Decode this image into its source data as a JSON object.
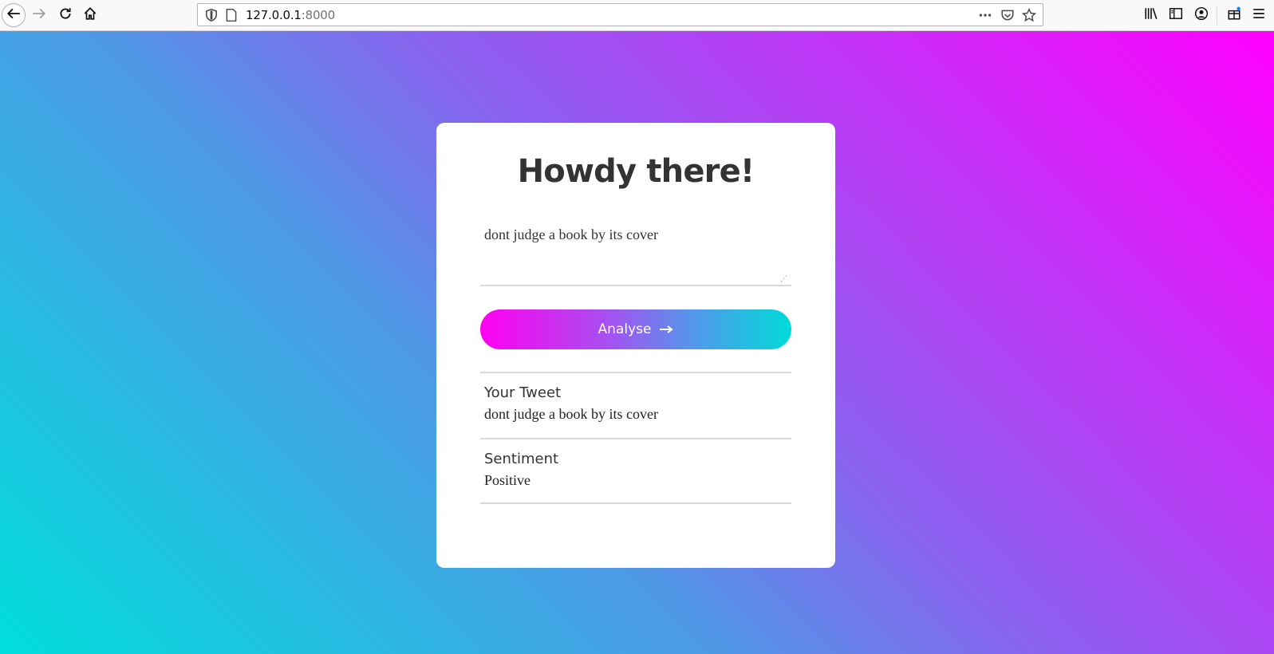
{
  "browser": {
    "url_host": "127.0.0.1",
    "url_port": ":8000",
    "icons": [
      "back-icon",
      "forward-icon",
      "reload-icon",
      "home-icon",
      "shield-icon",
      "page-icon",
      "more-icon",
      "pocket-icon",
      "star-icon",
      "library-icon",
      "sidebar-icon",
      "account-icon",
      "extensions-icon",
      "menu-icon"
    ]
  },
  "card": {
    "heading": "Howdy there!",
    "input_value": "dont judge a book by its cover",
    "analyse_label": "Analyse",
    "results": [
      {
        "label": "Your Tweet",
        "value": "dont judge a book by its cover"
      },
      {
        "label": "Sentiment",
        "value": "Positive"
      }
    ]
  },
  "colors": {
    "bg_gradient": [
      "#ff00ff",
      "#8a62ef",
      "#4f98e6",
      "#00dedc"
    ],
    "button_gradient": [
      "#ff00f0",
      "#a94ef0",
      "#4f9bea",
      "#00dbd8"
    ]
  }
}
